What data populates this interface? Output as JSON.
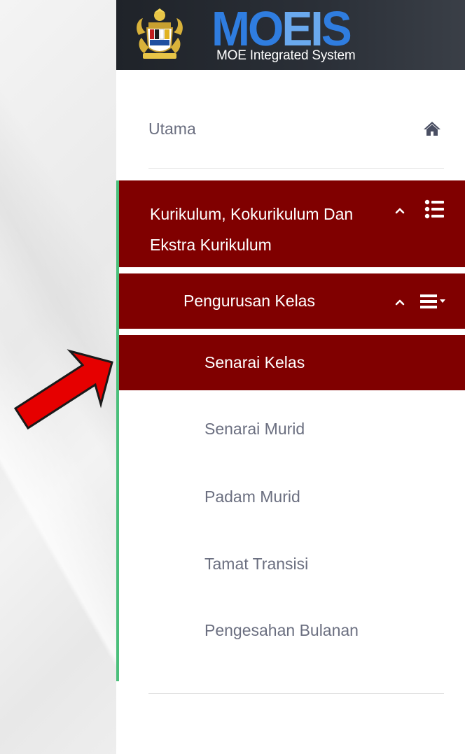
{
  "header": {
    "logo_text": "MOEIS",
    "logo_text_a": "MO",
    "logo_text_b": "EI",
    "logo_text_c": "S",
    "tagline": "MOE Integrated System"
  },
  "nav": {
    "home": {
      "label": "Utama",
      "icon": "home-icon"
    },
    "section": {
      "label": "Kurikulum, Kokurikulum Dan Ekstra Kurikulum",
      "icon": "list-icon",
      "expanded": true
    },
    "subsection": {
      "label": "Pengurusan Kelas",
      "icon": "bars-dropdown-icon",
      "expanded": true
    },
    "items": [
      {
        "label": "Senarai Kelas",
        "active": true
      },
      {
        "label": "Senarai Murid",
        "active": false
      },
      {
        "label": "Padam Murid",
        "active": false
      },
      {
        "label": "Tamat Transisi",
        "active": false
      },
      {
        "label": "Pengesahan Bulanan",
        "active": false
      }
    ]
  },
  "colors": {
    "active_bg": "#800000",
    "accent_bar": "#4bbf7b",
    "header_bg": "#2b3038",
    "logo_blue": "#2f7de0",
    "arrow": "#e60000"
  }
}
